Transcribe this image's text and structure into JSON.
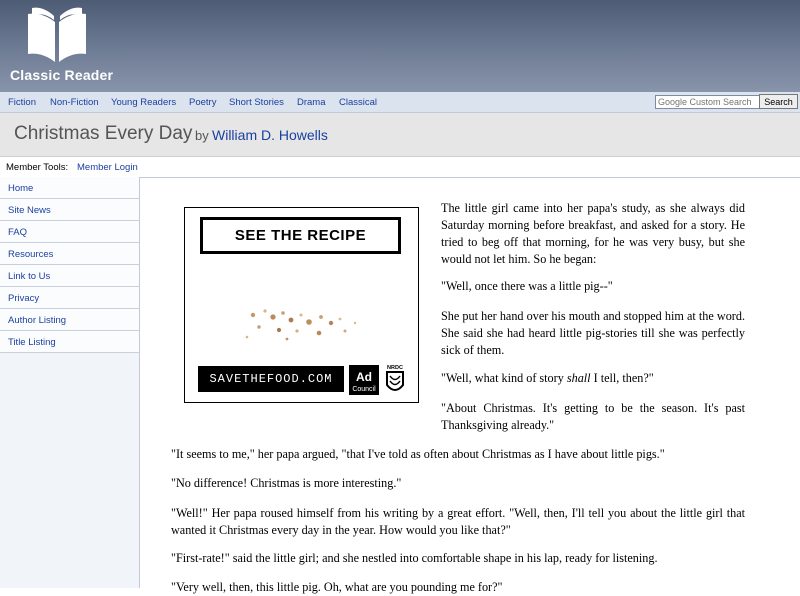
{
  "site": {
    "logo_text": "Classic Reader"
  },
  "nav": {
    "links": [
      "Fiction",
      "Non-Fiction",
      "Young Readers",
      "Poetry",
      "Short Stories",
      "Drama",
      "Classical"
    ],
    "search_placeholder": "Google Custom Search",
    "search_button": "Search"
  },
  "book": {
    "title": "Christmas Every Day",
    "by": "by",
    "author": "William D. Howells"
  },
  "member_tools": {
    "label": "Member Tools:",
    "login": "Member Login"
  },
  "sidebar": {
    "items": [
      "Home",
      "Site News",
      "FAQ",
      "Resources",
      "Link to Us",
      "Privacy",
      "Author Listing",
      "Title Listing"
    ]
  },
  "ad": {
    "headline": "SEE THE RECIPE",
    "url": "SAVETHEFOOD.COM",
    "council_top": "Ad",
    "council_bottom": "Council",
    "nrdc": "NRDC"
  },
  "story": {
    "p1": "The little girl came into her papa's study, as she always did Saturday morning before breakfast, and asked for a story. He tried to beg off that morning, for he was very busy, but she would not let him. So he began:",
    "p2": "\"Well, once there was a little pig--\"",
    "p3": "She put her hand over his mouth and stopped him at the word. She said she had heard little pig-stories till she was perfectly sick of them.",
    "p4_before": "\"Well, what kind of story ",
    "p4_em": "shall",
    "p4_after": " I tell, then?\"",
    "p5": "\"About Christmas. It's getting to be the season. It's past Thanksgiving already.\"",
    "p6": "\"It seems to me,\" her papa argued, \"that I've told as often about Christmas as I have about little pigs.\"",
    "p7": "\"No difference! Christmas is more interesting.\"",
    "p8": "\"Well!\" Her papa roused himself from his writing by a great effort. \"Well, then, I'll tell you about the little girl that wanted it Christmas every day in the year. How would you like that?\"",
    "p9": "\"First-rate!\" said the little girl; and she nestled into comfortable shape in his lap, ready for listening.",
    "p10": "\"Very well, then, this little pig. Oh, what are you pounding me for?\""
  }
}
